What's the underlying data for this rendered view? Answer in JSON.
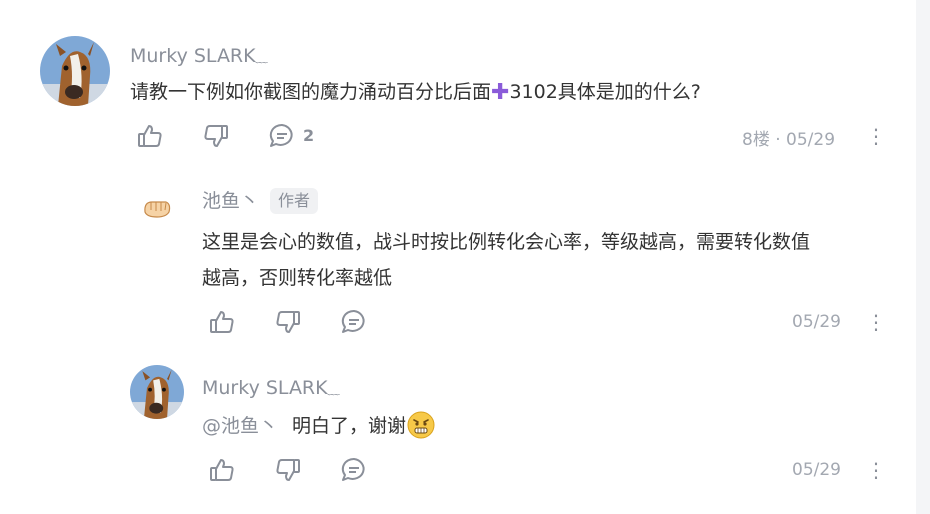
{
  "comment": {
    "author": "Murky SLARK",
    "text_before": "请教一下例如你截图的魔力涌动百分比后面",
    "text_after": "3102具体是加的什么?",
    "reply_count": "2",
    "floor_meta": "8楼 · 05/29"
  },
  "reply1": {
    "author": "池鱼丶",
    "badge": "作者",
    "line1": "这里是会心的数值，战斗时按比例转化会心率，等级越高，需要转化数值",
    "line2": "越高，否则转化率越低",
    "date": "05/29"
  },
  "reply2": {
    "author": "Murky SLARK",
    "mention": "@池鱼丶",
    "text": "明白了，谢谢",
    "date": "05/29"
  },
  "icons": {
    "like": "thumb-up-icon",
    "dislike": "thumb-down-icon",
    "reply": "comment-bubble-icon",
    "more": "more-vertical-icon",
    "plus": "plus-emoji-icon",
    "grin": "grimace-emoji-icon"
  },
  "colors": {
    "name": "#8a8f99",
    "text": "#333333",
    "plus": "#8a5bd9"
  }
}
